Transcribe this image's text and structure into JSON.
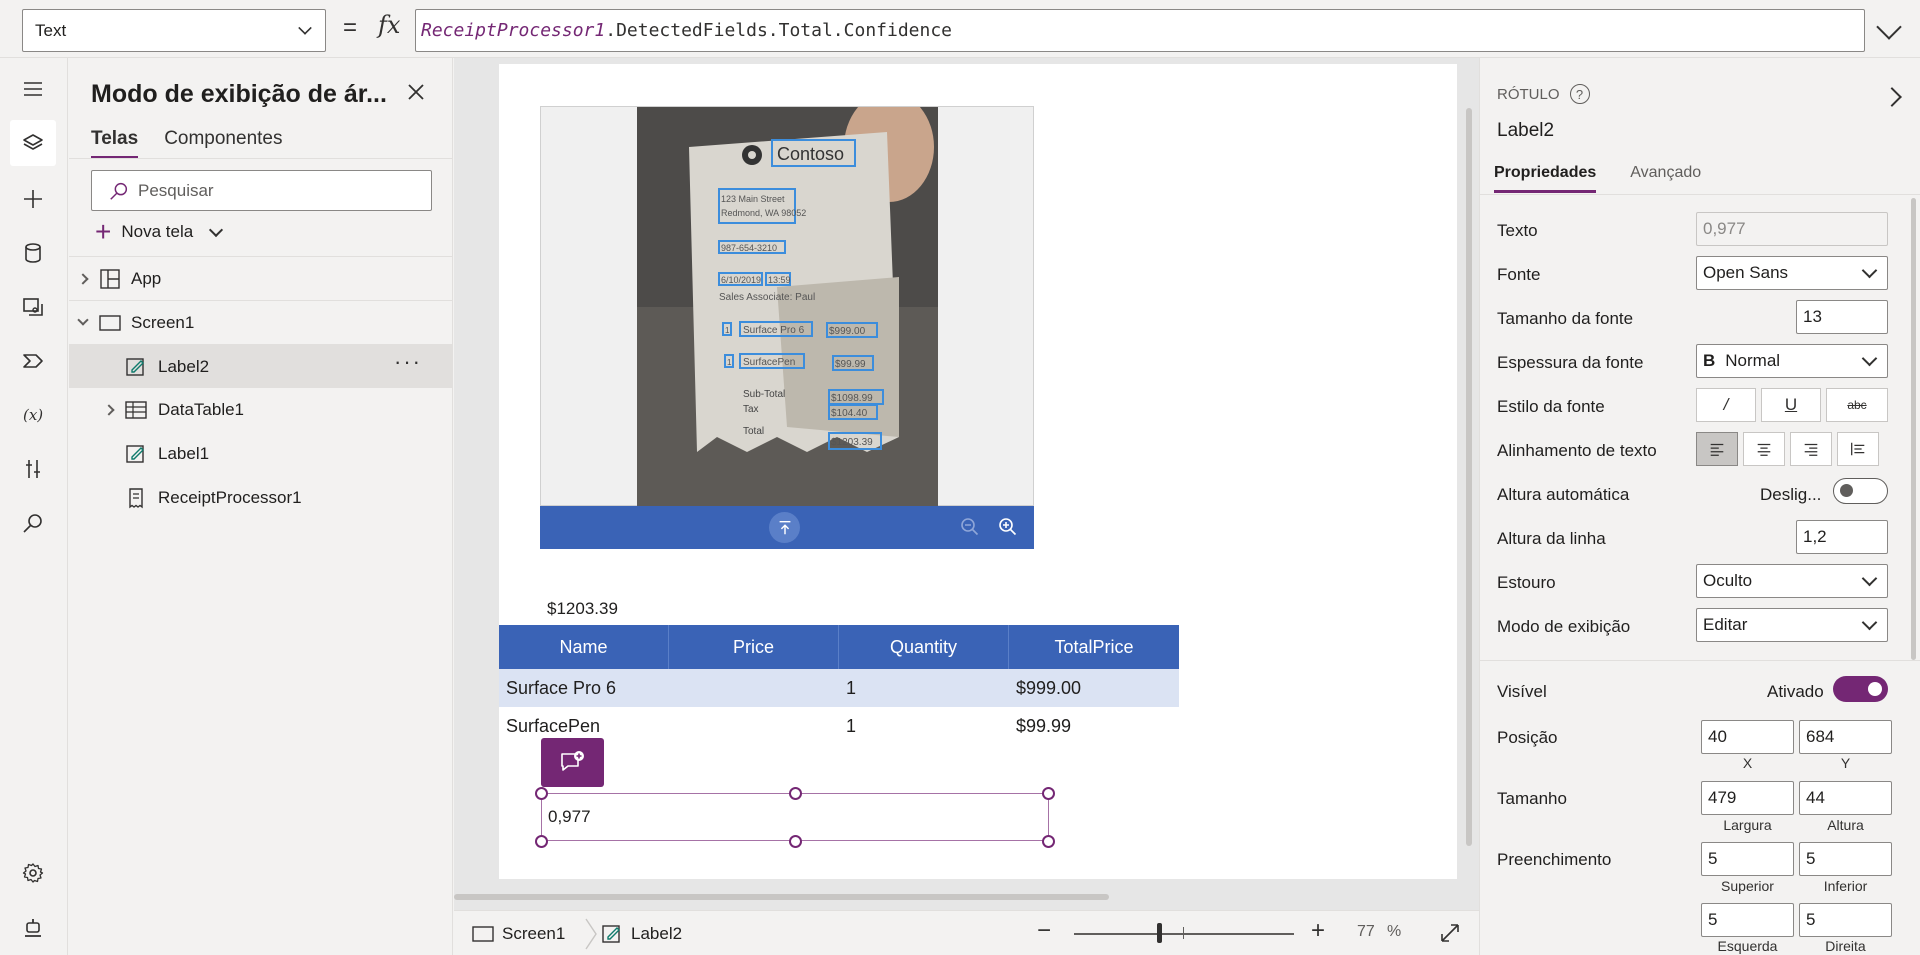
{
  "formula": {
    "property": "Text",
    "control_ref": "ReceiptProcessor1",
    "expression_rest": ".DetectedFields.Total.Confidence"
  },
  "tree": {
    "title": "Modo de exibição de ár...",
    "tabs": [
      "Telas",
      "Componentes"
    ],
    "search_placeholder": "Pesquisar",
    "new_screen": "Nova tela",
    "items": [
      {
        "label": "App"
      },
      {
        "label": "Screen1"
      },
      {
        "label": "Label2"
      },
      {
        "label": "DataTable1"
      },
      {
        "label": "Label1"
      },
      {
        "label": "ReceiptProcessor1"
      }
    ]
  },
  "canvas": {
    "total_label": "$1203.39",
    "table": {
      "headers": [
        "Name",
        "Price",
        "Quantity",
        "TotalPrice"
      ],
      "rows": [
        [
          "Surface Pro 6",
          "",
          "1",
          "$999.00"
        ],
        [
          "SurfacePen",
          "",
          "1",
          "$99.99"
        ]
      ]
    },
    "selected_label_text": "0,977",
    "receipt": {
      "brand": "Contoso",
      "address1": "123 Main Street",
      "address2": "Redmond, WA 98052",
      "phone": "987-654-3210",
      "date": "6/10/2019",
      "time": "13:59",
      "associate": "Sales Associate: Paul",
      "line1_qty": "1",
      "line1_item": "Surface Pro 6",
      "line1_price": "$999.00",
      "line2_qty": "1",
      "line2_item": "SurfacePen",
      "line2_price": "$99.99",
      "subtotal_label": "Sub-Total",
      "subtotal": "$1098.99",
      "tax_label": "Tax",
      "tax": "$104.40",
      "total_label": "Total",
      "total": "$1203.39"
    }
  },
  "status": {
    "screen": "Screen1",
    "control": "Label2",
    "zoom": "77",
    "zoom_unit": "%",
    "zoom_fraction": 0.39
  },
  "props": {
    "kind": "RÓTULO",
    "name": "Label2",
    "tabs": [
      "Propriedades",
      "Avançado"
    ],
    "texto_label": "Texto",
    "texto": "0,977",
    "fonte_label": "Fonte",
    "fonte": "Open Sans",
    "tamanho_label": "Tamanho da fonte",
    "tamanho": "13",
    "espessura_label": "Espessura da fonte",
    "espessura": "Normal",
    "estilo_label": "Estilo da fonte",
    "alinhamento_label": "Alinhamento de texto",
    "altura_auto_label": "Altura automática",
    "altura_auto": "Deslig...",
    "altura_linha_label": "Altura da linha",
    "altura_linha": "1,2",
    "estouro_label": "Estouro",
    "estouro": "Oculto",
    "modo_label": "Modo de exibição",
    "modo": "Editar",
    "visivel_label": "Visível",
    "visivel": "Ativado",
    "posicao_label": "Posição",
    "pos_x": "40",
    "pos_y": "684",
    "x_label": "X",
    "y_label": "Y",
    "tamanho2_label": "Tamanho",
    "largura": "479",
    "altura": "44",
    "largura_label": "Largura",
    "altura_label": "Altura",
    "preenchimento_label": "Preenchimento",
    "superior": "5",
    "inferior": "5",
    "superior_label": "Superior",
    "inferior_label": "Inferior",
    "esquerda": "5",
    "direita": "5",
    "esquerda_label": "Esquerda",
    "direita_label": "Direita"
  },
  "colors": {
    "accent": "#742774",
    "table_header": "#3a63b6",
    "table_alt_row": "#dbe3f3"
  }
}
